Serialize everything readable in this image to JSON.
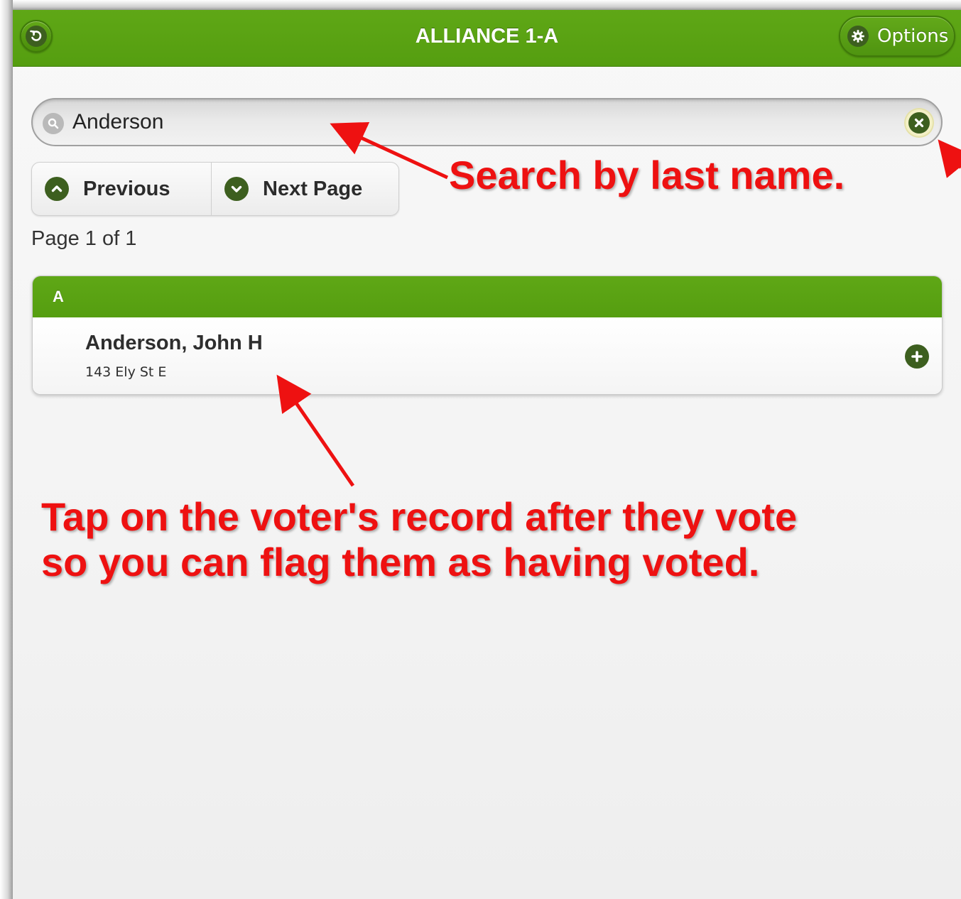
{
  "header": {
    "title": "ALLIANCE 1-A",
    "options_label": "Options"
  },
  "search": {
    "value": "Anderson"
  },
  "pager": {
    "previous_label": "Previous",
    "next_label": "Next Page",
    "page_info": "Page 1 of 1"
  },
  "list": {
    "divider": "A",
    "items": [
      {
        "name": "Anderson, John H",
        "address": "143 Ely St E"
      }
    ]
  },
  "annotations": {
    "search_hint": "Search by last name.",
    "tap_hint": "Tap on the voter's record after they vote\nso you can flag them as having voted."
  },
  "colors": {
    "header_green": "#5fa716",
    "icon_dark": "#3d5f1f",
    "annotation_red": "#ee1111"
  }
}
